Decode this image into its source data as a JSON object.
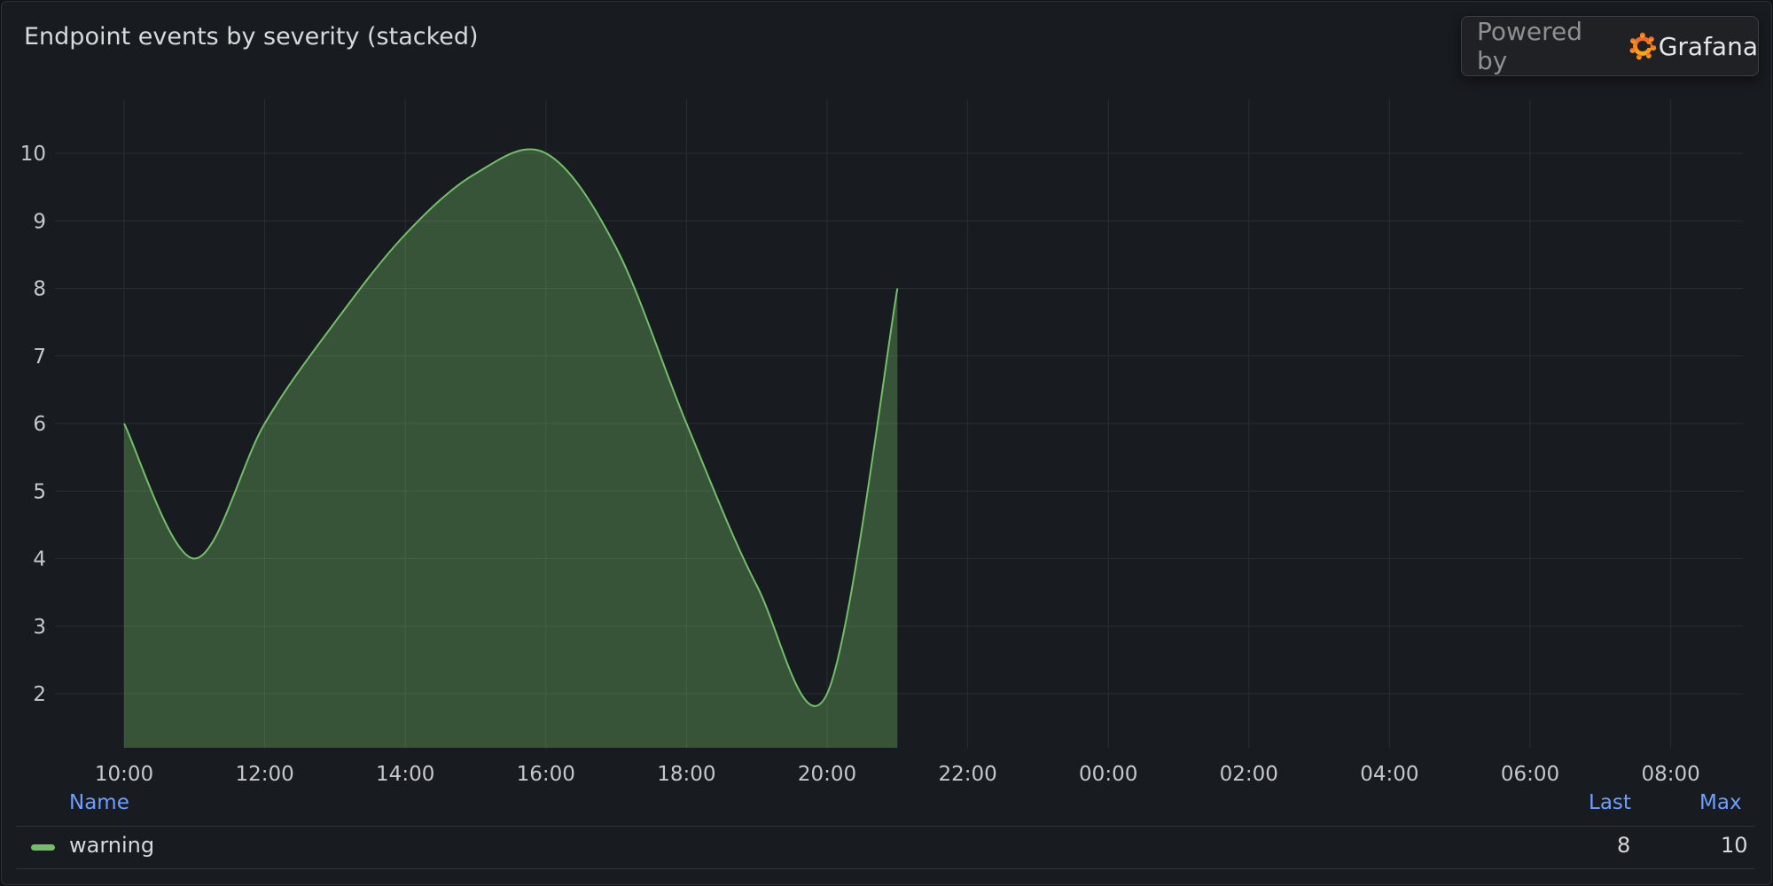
{
  "panel": {
    "title": "Endpoint events by severity (stacked)",
    "badge": {
      "powered_by": "Powered by",
      "brand": "Grafana"
    }
  },
  "chart_data": {
    "type": "area",
    "title": "Endpoint events by severity (stacked)",
    "stacked": true,
    "x_ticks": [
      "10:00",
      "12:00",
      "14:00",
      "16:00",
      "18:00",
      "20:00",
      "22:00",
      "00:00",
      "02:00",
      "04:00",
      "06:00",
      "08:00"
    ],
    "y_ticks": [
      2,
      3,
      4,
      5,
      6,
      7,
      8,
      9,
      10
    ],
    "ylim": [
      1.2,
      10.8
    ],
    "grid": true,
    "legend_position": "bottom",
    "series": [
      {
        "name": "warning",
        "color": "#73bf69",
        "x": [
          "10:00",
          "11:00",
          "12:00",
          "13:00",
          "14:00",
          "15:00",
          "16:00",
          "17:00",
          "18:00",
          "19:00",
          "20:00",
          "21:00"
        ],
        "values": [
          6,
          4,
          6,
          7.5,
          8.8,
          9.7,
          10,
          8.6,
          6,
          3.6,
          2,
          8
        ]
      }
    ]
  },
  "legend": {
    "headers": {
      "name": "Name",
      "last": "Last",
      "max": "Max"
    },
    "rows": [
      {
        "name": "warning",
        "last": "8",
        "max": "10"
      }
    ]
  }
}
